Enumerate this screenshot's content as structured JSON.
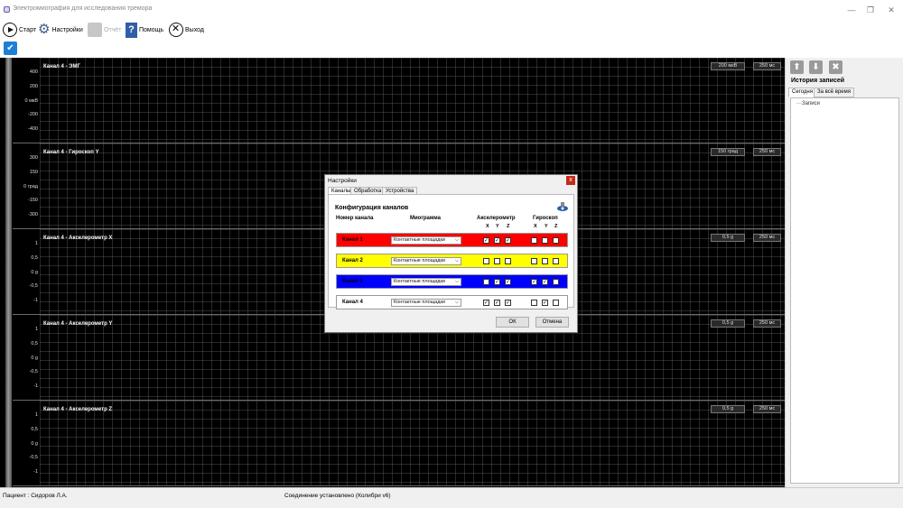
{
  "window": {
    "title": "Электромиография для исследования тремора",
    "minimize": "—",
    "maximize": "❐",
    "close": "✕"
  },
  "toolbar": {
    "start_label": "Старт",
    "settings_label": "Настройки",
    "report_label": "Отчёт",
    "help_label": "Помощь",
    "exit_label": "Выход"
  },
  "channels": [
    {
      "label": "Канал 4 - ЭМГ",
      "ticks": [
        "400",
        "200",
        "0 мкВ",
        "-200",
        "-400"
      ],
      "scale": "200 мкВ",
      "time": "250 мс"
    },
    {
      "label": "Канал 4 - Гироскоп Y",
      "ticks": [
        "300",
        "150",
        "0 град",
        "-150",
        "-300"
      ],
      "scale": "150 град",
      "time": "250 мс"
    },
    {
      "label": "Канал 4 - Акселерометр X",
      "ticks": [
        "1",
        "0,5",
        "0 g",
        "-0,5",
        "-1"
      ],
      "scale": "0,5 g",
      "time": "250 мс"
    },
    {
      "label": "Канал 4 - Акселерометр Y",
      "ticks": [
        "1",
        "0,5",
        "0 g",
        "-0,5",
        "-1"
      ],
      "scale": "0,5 g",
      "time": "250 мс"
    },
    {
      "label": "Канал 4 - Акселерометр Z",
      "ticks": [
        "1",
        "0,5",
        "0 g",
        "-0,5",
        "-1"
      ],
      "scale": "0,5 g",
      "time": "250 мс"
    }
  ],
  "history": {
    "title": "История записей",
    "tab_today": "Сегодня",
    "tab_all": "За всё время",
    "tree_root": "Записи"
  },
  "status": {
    "patient": "Пациент : Сидоров Л.А.",
    "connection": "Соединение установлено (Колибри v6)"
  },
  "dialog": {
    "title": "Настройки",
    "close": "x",
    "tabs": [
      "Каналы",
      "Обработка",
      "Устройства"
    ],
    "heading": "Конфигурация каналов",
    "col_channel": "Номер канала",
    "col_myogram": "Миограмма",
    "col_accel": "Акселерометр",
    "col_gyro": "Гироскоп",
    "axis_x": "X",
    "axis_y": "Y",
    "axis_z": "Z",
    "rows": [
      {
        "name": "Канал 1",
        "color": "#ff0000",
        "select": "Контактные площадки",
        "accel": [
          true,
          true,
          true
        ],
        "gyro": [
          false,
          false,
          false
        ]
      },
      {
        "name": "Канал 2",
        "color": "#ffff00",
        "select": "Контактные площадки",
        "accel": [
          false,
          false,
          false
        ],
        "gyro": [
          false,
          false,
          false
        ]
      },
      {
        "name": "Канал 3",
        "color": "#0000ff",
        "select": "Контактные площадки",
        "accel": [
          false,
          true,
          true
        ],
        "gyro": [
          true,
          true,
          false
        ]
      },
      {
        "name": "Канал 4",
        "color": "#ffffff",
        "select": "Контактные площадки",
        "accel": [
          true,
          true,
          true
        ],
        "gyro": [
          false,
          true,
          false
        ]
      }
    ],
    "ok": "ОК",
    "cancel": "Отмена"
  }
}
